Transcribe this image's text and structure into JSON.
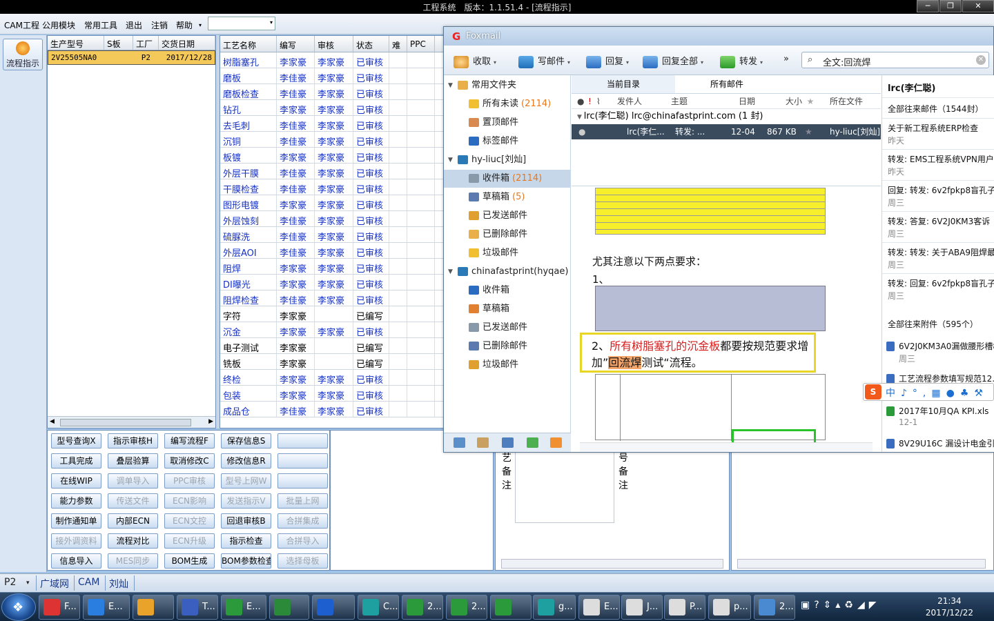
{
  "app": {
    "title": "工程系统　版本：1.1.51.4 - [流程指示]",
    "win_buttons": [
      "─",
      "❐",
      "✕"
    ]
  },
  "menu": {
    "items": [
      "CAM工程",
      "公用模块",
      "常用工具",
      "退出",
      "注销",
      "帮助"
    ],
    "help_arrow": "▾",
    "combo_arrow": "▾"
  },
  "left": {
    "flow_button": "流程指示"
  },
  "orders": {
    "headers": [
      "生产型号",
      "S板",
      "工厂",
      "交货日期"
    ],
    "row": [
      "2V25505NA0",
      "",
      "P2",
      "2017/12/28"
    ]
  },
  "process": {
    "headers": [
      "工艺名称",
      "编写",
      "审核",
      "状态",
      "难",
      "PPC"
    ],
    "rows": [
      {
        "name": "树脂塞孔",
        "writer": "李家豪",
        "reviewer": "李家豪",
        "status": "已审核",
        "active": true
      },
      {
        "name": "磨板",
        "writer": "李佳豪",
        "reviewer": "李家豪",
        "status": "已审核",
        "active": true
      },
      {
        "name": "磨板检查",
        "writer": "李佳豪",
        "reviewer": "李家豪",
        "status": "已审核",
        "active": true
      },
      {
        "name": "钻孔",
        "writer": "李家豪",
        "reviewer": "李家豪",
        "status": "已审核",
        "active": true
      },
      {
        "name": "去毛刺",
        "writer": "李佳豪",
        "reviewer": "李家豪",
        "status": "已审核",
        "active": true
      },
      {
        "name": "沉铜",
        "writer": "李佳豪",
        "reviewer": "李家豪",
        "status": "已审核",
        "active": true
      },
      {
        "name": "板镀",
        "writer": "李家豪",
        "reviewer": "李家豪",
        "status": "已审核",
        "active": true
      },
      {
        "name": "外层干膜",
        "writer": "李佳豪",
        "reviewer": "李家豪",
        "status": "已审核",
        "active": true
      },
      {
        "name": "干膜检查",
        "writer": "李佳豪",
        "reviewer": "李家豪",
        "status": "已审核",
        "active": true
      },
      {
        "name": "图形电镀",
        "writer": "李家豪",
        "reviewer": "李家豪",
        "status": "已审核",
        "active": true
      },
      {
        "name": "外层蚀刻",
        "writer": "李佳豪",
        "reviewer": "李家豪",
        "status": "已审核",
        "active": true
      },
      {
        "name": "硫脲洗",
        "writer": "李佳豪",
        "reviewer": "李家豪",
        "status": "已审核",
        "active": true
      },
      {
        "name": "外层AOI",
        "writer": "李佳豪",
        "reviewer": "李家豪",
        "status": "已审核",
        "active": true
      },
      {
        "name": "阻焊",
        "writer": "李家豪",
        "reviewer": "李家豪",
        "status": "已审核",
        "active": true
      },
      {
        "name": "DI曝光",
        "writer": "李家豪",
        "reviewer": "李家豪",
        "status": "已审核",
        "active": true
      },
      {
        "name": "阻焊检查",
        "writer": "李佳豪",
        "reviewer": "李家豪",
        "status": "已审核",
        "active": true
      },
      {
        "name": "字符",
        "writer": "李家豪",
        "reviewer": "",
        "status": "已编写",
        "active": false
      },
      {
        "name": "沉金",
        "writer": "李家豪",
        "reviewer": "李家豪",
        "status": "已审核",
        "active": true
      },
      {
        "name": "电子测试",
        "writer": "李家豪",
        "reviewer": "",
        "status": "已编写",
        "active": false
      },
      {
        "name": "铣板",
        "writer": "李家豪",
        "reviewer": "",
        "status": "已编写",
        "active": false
      },
      {
        "name": "终检",
        "writer": "李家豪",
        "reviewer": "李家豪",
        "status": "已审核",
        "active": true
      },
      {
        "name": "包装",
        "writer": "李家豪",
        "reviewer": "李家豪",
        "status": "已审核",
        "active": true
      },
      {
        "name": "成品仓",
        "writer": "李佳豪",
        "reviewer": "李家豪",
        "status": "已审核",
        "active": true
      }
    ]
  },
  "buttons": [
    [
      "型号查询X",
      "指示审核H",
      "编写流程F",
      "保存信息S",
      ""
    ],
    [
      "工具完成",
      "叠层验算",
      "取消修改C",
      "修改信息R",
      ""
    ],
    [
      "在线WIP",
      "调单导入",
      "PPC审核",
      "型号上网W",
      ""
    ],
    [
      "能力参数",
      "传送文件",
      "ECN影响",
      "发送指示V",
      "批量上网"
    ],
    [
      "制作通知单",
      "内部ECN",
      "ECN文控",
      "回退审核B",
      "合拼集成"
    ],
    [
      "接外调资料",
      "流程对比",
      "ECN升级",
      "指示检查",
      "合拼导入"
    ],
    [
      "信息导入",
      "MES同步",
      "BOM生成",
      "BOM参数检查",
      "选择母板"
    ]
  ],
  "buttons_disabled": [
    [
      false,
      false,
      false,
      false,
      false
    ],
    [
      false,
      false,
      false,
      false,
      false
    ],
    [
      false,
      true,
      true,
      true,
      false
    ],
    [
      false,
      true,
      true,
      true,
      true
    ],
    [
      false,
      false,
      true,
      false,
      true
    ],
    [
      true,
      false,
      true,
      false,
      true
    ],
    [
      false,
      true,
      false,
      false,
      true
    ]
  ],
  "lower": {
    "vlabel_a": [
      "艺",
      "备",
      "注"
    ],
    "vlabel_b": [
      "号",
      "备",
      "注"
    ]
  },
  "status": {
    "factory": "P2",
    "items": [
      "广域网",
      "CAM",
      "刘灿"
    ]
  },
  "taskbar": {
    "items": [
      "F...",
      "E...",
      "",
      "T...",
      "E...",
      "",
      "",
      "C...",
      "2...",
      "2...",
      "",
      "g...",
      "E...",
      "J...",
      "P...",
      "p...",
      "2..."
    ],
    "time": "21:34",
    "date": "2017/12/22"
  },
  "foxmail": {
    "title": "Foxmail",
    "toolbar": [
      "收取",
      "写邮件",
      "回复",
      "回复全部",
      "转发",
      "»"
    ],
    "search": "全文:回流焊",
    "nav": [
      {
        "label": "常用文件夹",
        "count": "",
        "level": 0
      },
      {
        "label": "所有未读",
        "count": "(2114)",
        "level": 1
      },
      {
        "label": "置顶邮件",
        "count": "",
        "level": 1
      },
      {
        "label": "标签邮件",
        "count": "",
        "level": 1
      },
      {
        "label": "hy-liuc[刘灿]",
        "count": "",
        "level": 0
      },
      {
        "label": "收件箱",
        "count": "(2114)",
        "level": 1,
        "sel": true
      },
      {
        "label": "草稿箱",
        "count": "(5)",
        "level": 1
      },
      {
        "label": "已发送邮件",
        "count": "",
        "level": 1
      },
      {
        "label": "已删除邮件",
        "count": "",
        "level": 1
      },
      {
        "label": "垃圾邮件",
        "count": "",
        "level": 1
      },
      {
        "label": "chinafastprint(hyqae)",
        "count": "",
        "level": 0
      },
      {
        "label": "收件箱",
        "count": "",
        "level": 1
      },
      {
        "label": "草稿箱",
        "count": "",
        "level": 1
      },
      {
        "label": "已发送邮件",
        "count": "",
        "level": 1
      },
      {
        "label": "已删除邮件",
        "count": "",
        "level": 1
      },
      {
        "label": "垃圾邮件",
        "count": "",
        "level": 1
      }
    ],
    "tabs": [
      "当前目录",
      "所有邮件"
    ],
    "cols": [
      "!",
      "发件人",
      "主题",
      "日期",
      "大小",
      "★",
      "所在文件"
    ],
    "group": "lrc(李仁聪)  lrc@chinafastprint.com (1 封)",
    "mail": {
      "from": "lrc(李仁...",
      "subject": "转发: ...",
      "date": "12-04",
      "size": "867 KB",
      "folder": "hy-liuc[刘灿]"
    },
    "body": {
      "p1": "尤其注意以下两点要求：",
      "p2": "1、",
      "box_pre": "2、",
      "box_red": "所有树脂塞孔的沉金板",
      "box_mid": "都要按规范要求增",
      "box_l2a": "加”",
      "box_hl": "回流焊",
      "box_l2b": "测试“流程。"
    },
    "contact": {
      "name": "lrc(李仁聪)",
      "all_mail": "全部往来邮件（1544封）",
      "mails": [
        [
          "关于新工程系统ERP检查",
          "昨天"
        ],
        [
          "转发: EMS工程系统VPN用户",
          "昨天"
        ],
        [
          "回复: 转发: 6v2fpkp8盲孔子",
          "周三"
        ],
        [
          "转发: 答复: 6V2J0KM3客诉",
          "周三"
        ],
        [
          "转发: 转发: 关于ABA9阻焊最",
          "周三"
        ],
        [
          "转发: 回复: 6v2fpkp8盲孔子",
          "周三"
        ]
      ],
      "attach": "全部往来附件（595个）",
      "files": [
        [
          "6V2J0KM3A0漏做腰形槽8",
          "周三"
        ],
        [
          "工艺流程参数填写规范12...",
          ""
        ],
        [
          "2017年10月QA KPI.xls",
          "12-1"
        ],
        [
          "8V29U16C 漏设计电金引...",
          ""
        ]
      ]
    }
  }
}
